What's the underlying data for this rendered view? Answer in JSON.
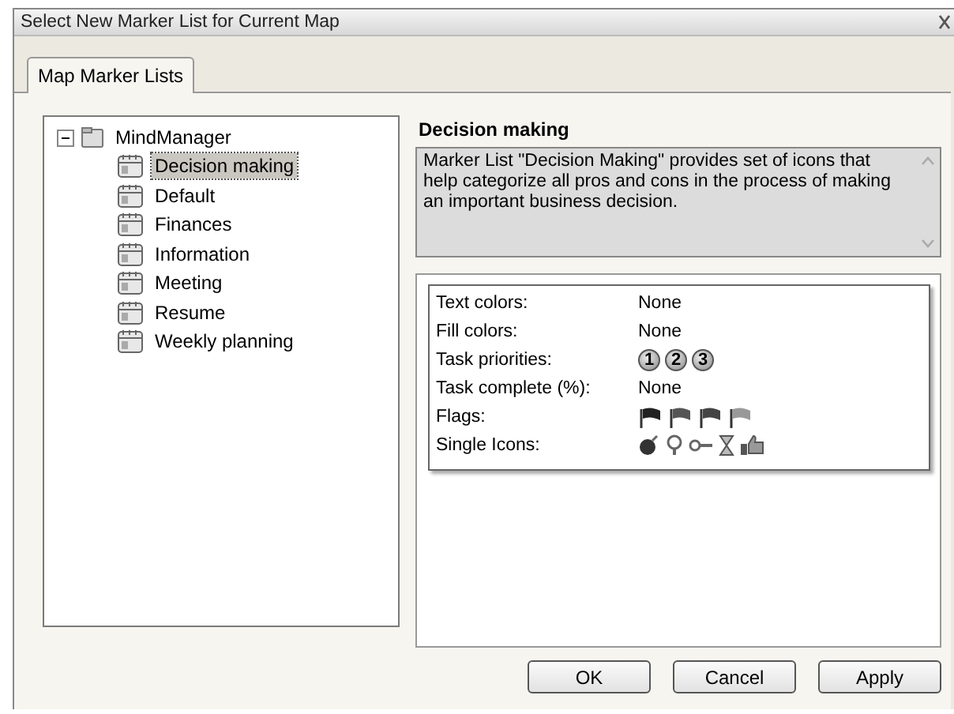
{
  "window": {
    "title": "Select New Marker List for Current Map"
  },
  "tabs": [
    {
      "label": "Map Marker Lists",
      "selected": true
    }
  ],
  "tree": {
    "label": "MindManager",
    "expanded": true,
    "children": [
      {
        "label": "Decision making",
        "selected": true
      },
      {
        "label": "Default",
        "selected": false
      },
      {
        "label": "Finances",
        "selected": false
      },
      {
        "label": "Information",
        "selected": false
      },
      {
        "label": "Meeting",
        "selected": false
      },
      {
        "label": "Resume",
        "selected": false
      },
      {
        "label": "Weekly planning",
        "selected": false
      }
    ]
  },
  "details": {
    "heading": "Decision making",
    "description": "Marker List \"Decision Making\" provides set of icons that help categorize all pros and cons in the process of making an important business decision.",
    "properties": [
      {
        "label": "Text colors:",
        "kind": "text",
        "value": "None"
      },
      {
        "label": "Fill colors:",
        "kind": "text",
        "value": "None"
      },
      {
        "label": "Task priorities:",
        "kind": "priorities",
        "icons": [
          "1",
          "2",
          "3"
        ]
      },
      {
        "label": "Task complete (%):",
        "kind": "text",
        "value": "None"
      },
      {
        "label": "Flags:",
        "kind": "flags"
      },
      {
        "label": "Single Icons:",
        "kind": "icons"
      }
    ]
  },
  "buttons": [
    "OK",
    "Cancel",
    "Apply"
  ]
}
